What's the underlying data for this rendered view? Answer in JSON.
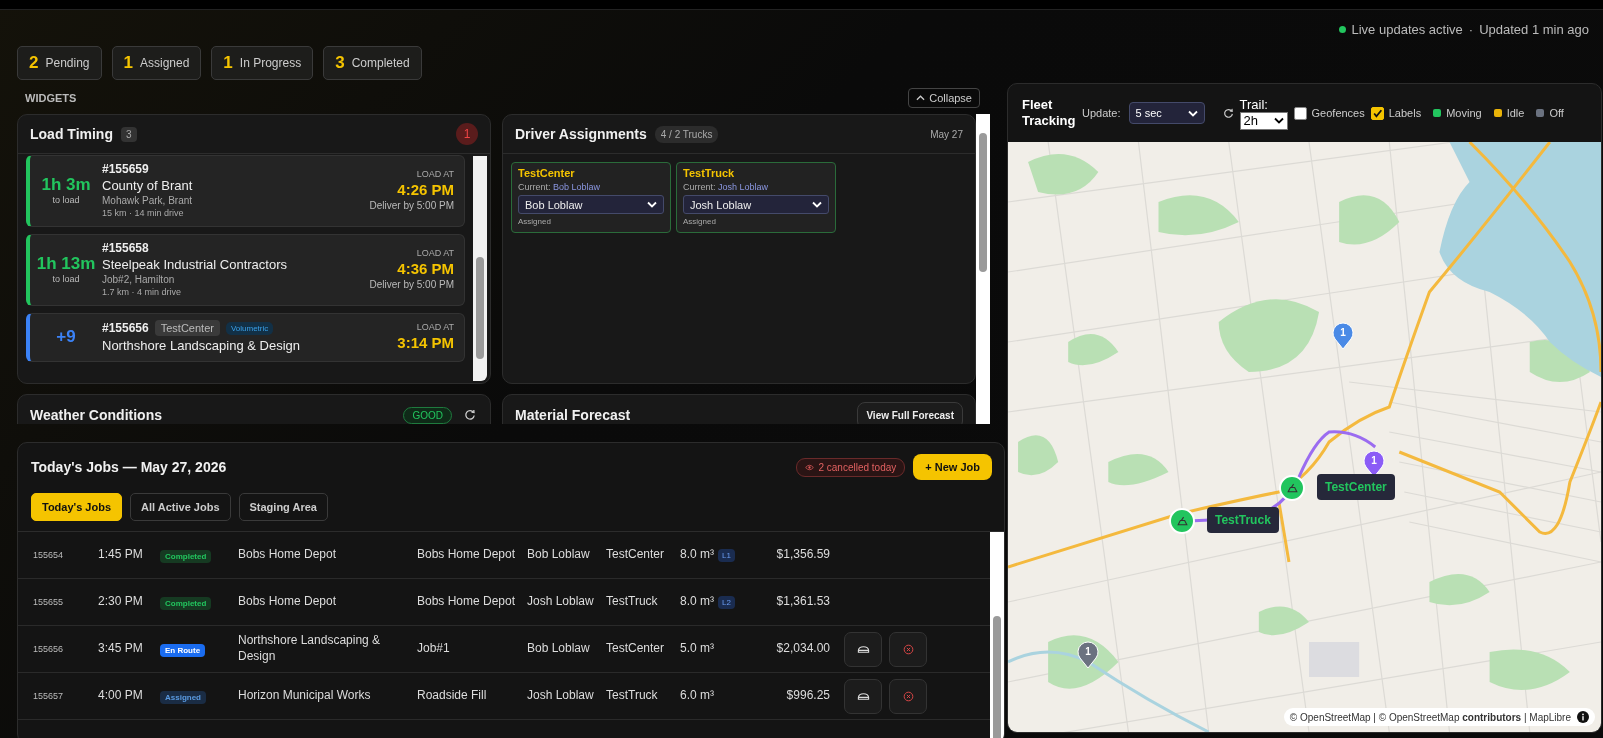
{
  "status": {
    "live": "Live updates active",
    "separator": "·",
    "updated": "Updated 1 min ago"
  },
  "stats": [
    {
      "count": "2",
      "label": "Pending"
    },
    {
      "count": "1",
      "label": "Assigned"
    },
    {
      "count": "1",
      "label": "In Progress"
    },
    {
      "count": "3",
      "label": "Completed"
    }
  ],
  "widgets": {
    "heading": "WIDGETS",
    "collapse": "Collapse"
  },
  "load_timing": {
    "title": "Load Timing",
    "count": "3",
    "alerts": "1",
    "items": [
      {
        "kind": "upcoming",
        "countdown": "1h 3m",
        "countdown_label": "to load",
        "job": "#155659",
        "customer": "County of Brant",
        "location": "Mohawk Park, Brant",
        "distance": "15 km · 14 min drive",
        "load_label": "LOAD AT",
        "load_time": "4:26 PM",
        "deliver": "Deliver by 5:00 PM"
      },
      {
        "kind": "upcoming",
        "countdown": "1h 13m",
        "countdown_label": "to load",
        "job": "#155658",
        "customer": "Steelpeak Industrial Contractors",
        "location": "Job#2, Hamilton",
        "distance": "1.7 km · 4 min drive",
        "load_label": "LOAD AT",
        "load_time": "4:36 PM",
        "deliver": "Deliver by 5:00 PM"
      },
      {
        "kind": "overdue",
        "countdown": "+9",
        "job": "#155656",
        "tags": [
          {
            "label": "TestCenter",
            "kind": "truck"
          },
          {
            "label": "Volumetric",
            "kind": "type"
          }
        ],
        "customer": "Northshore Landscaping & Design",
        "load_label": "LOAD AT",
        "load_time": "3:14 PM"
      }
    ]
  },
  "driver_assignments": {
    "title": "Driver Assignments",
    "count": "4 / 2 Trucks",
    "date": "May 27",
    "trucks": [
      {
        "name": "TestCenter",
        "current_label": "Current:",
        "current_driver": "Bob Loblaw",
        "selected_driver": "Bob Loblaw",
        "status": "Assigned"
      },
      {
        "name": "TestTruck",
        "current_label": "Current:",
        "current_driver": "Josh Loblaw",
        "selected_driver": "Josh Loblaw",
        "status": "Assigned"
      }
    ]
  },
  "weather": {
    "title": "Weather Conditions",
    "status": "GOOD"
  },
  "material_forecast": {
    "title": "Material Forecast",
    "button": "View Full Forecast"
  },
  "jobs": {
    "title": "Today's Jobs — May 27, 2026",
    "cancelled": "2 cancelled today",
    "new_job": "+ New Job",
    "tabs": [
      {
        "label": "Today's Jobs",
        "selected": true
      },
      {
        "label": "All Active Jobs",
        "selected": false
      },
      {
        "label": "Staging Area",
        "selected": false
      }
    ],
    "rows": [
      {
        "id": "155654",
        "time": "1:45 PM",
        "status": "Completed",
        "kind": "completed",
        "customer": "Bobs Home Depot",
        "site": "Bobs Home Depot",
        "driver": "Bob Loblaw",
        "truck": "TestCenter",
        "volume": "8.0 m³",
        "load_tag": "L1",
        "amount": "$1,356.59",
        "actions": false
      },
      {
        "id": "155655",
        "time": "2:30 PM",
        "status": "Completed",
        "kind": "completed",
        "customer": "Bobs Home Depot",
        "site": "Bobs Home Depot",
        "driver": "Josh Loblaw",
        "truck": "TestTruck",
        "volume": "8.0 m³",
        "load_tag": "L2",
        "amount": "$1,361.53",
        "actions": false
      },
      {
        "id": "155656",
        "time": "3:45 PM",
        "status": "En Route",
        "kind": "en_route",
        "customer": "Northshore Landscaping & Design",
        "site": "Job#1",
        "driver": "Bob Loblaw",
        "truck": "TestCenter",
        "volume": "5.0 m³",
        "amount": "$2,034.00",
        "actions": true
      },
      {
        "id": "155657",
        "time": "4:00 PM",
        "status": "Assigned",
        "kind": "assigned",
        "customer": "Horizon Municipal Works",
        "site": "Roadside Fill",
        "driver": "Josh Loblaw",
        "truck": "TestTruck",
        "volume": "6.0 m³",
        "amount": "$996.25",
        "actions": true
      }
    ]
  },
  "fleet": {
    "title": "Fleet Tracking",
    "update_label": "Update:",
    "update_value": "5 sec",
    "trail_label": "Trail:",
    "trail_value": "2h",
    "toggles": [
      {
        "label": "Geofences",
        "checked": false
      },
      {
        "label": "Labels",
        "checked": true
      }
    ],
    "legend": [
      {
        "label": "Moving",
        "color": "#22c55e"
      },
      {
        "label": "Idle",
        "color": "#eab308"
      },
      {
        "label": "Off",
        "color": "#6b7280"
      }
    ],
    "pins": [
      {
        "count": "1",
        "color": "#4a8ae6"
      },
      {
        "count": "1",
        "color": "#8b5cf6"
      },
      {
        "count": "1",
        "color": "#6b7280"
      }
    ],
    "vehicles": [
      {
        "label": "TestCenter",
        "color": "#22c55e"
      },
      {
        "label": "TestTruck",
        "color": "#22c55e"
      }
    ],
    "attribution": "© OpenStreetMap | © OpenStreetMap **contributors** | MapLibre"
  }
}
